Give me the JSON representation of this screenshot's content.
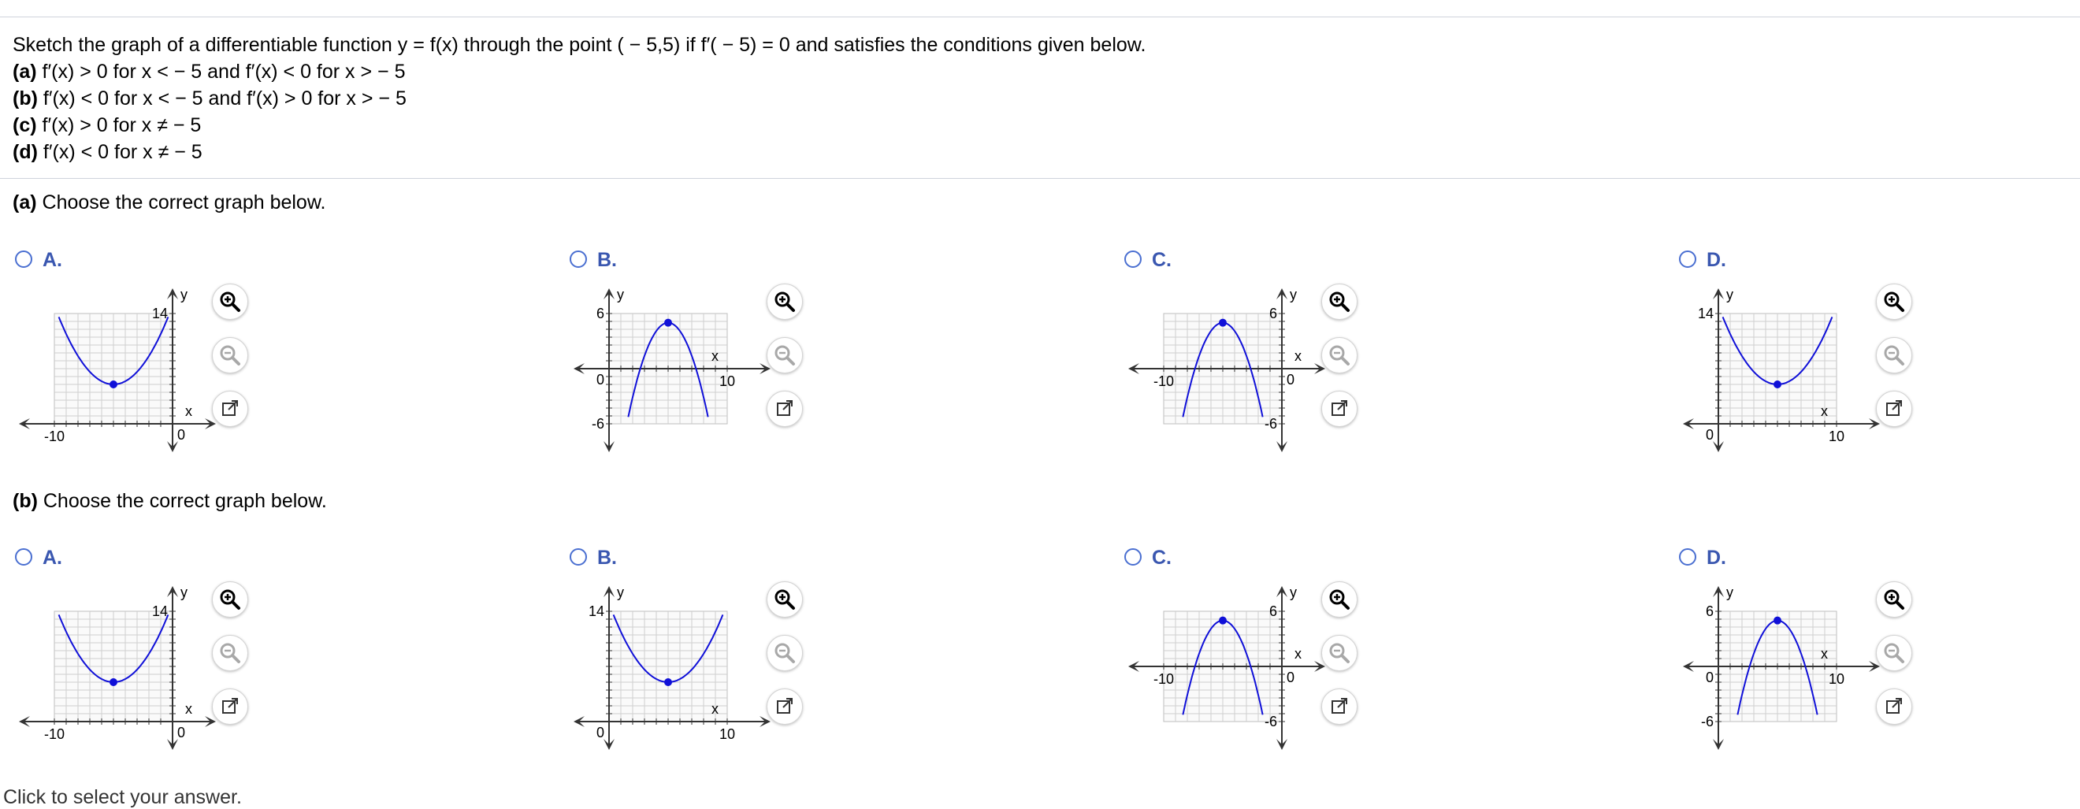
{
  "problem": {
    "intro": "Sketch the graph of a differentiable function y = f(x) through the point ( − 5,5) if f′( − 5) = 0 and satisfies the conditions given below.",
    "conditions": [
      {
        "label": "(a)",
        "text": "f′(x) > 0 for x < − 5 and f′(x) < 0 for x > − 5"
      },
      {
        "label": "(b)",
        "text": "f′(x) < 0 for x < − 5 and f′(x) > 0 for x > − 5"
      },
      {
        "label": "(c)",
        "text": "f′(x) > 0 for x ≠ − 5"
      },
      {
        "label": "(d)",
        "text": "f′(x) < 0 for x ≠ − 5"
      }
    ]
  },
  "parts": [
    {
      "label": "(a)",
      "prompt": "Choose the correct graph below.",
      "choices": [
        {
          "letter": "A.",
          "graph": {
            "shape": "up",
            "x_range": [
              -10,
              0
            ],
            "y_range": [
              0,
              14
            ],
            "x_tick": "-10",
            "y_tick": "14",
            "origin_tick": "0",
            "x_axis_label": "x",
            "y_axis_label": "y"
          }
        },
        {
          "letter": "B.",
          "graph": {
            "shape": "down",
            "x_range": [
              0,
              10
            ],
            "y_range": [
              -6,
              6
            ],
            "x_tick": "10",
            "y_tick": "6",
            "y_tick_neg": "-6",
            "origin_tick": "0",
            "x_axis_label": "x",
            "y_axis_label": "y"
          }
        },
        {
          "letter": "C.",
          "graph": {
            "shape": "down",
            "x_range": [
              -10,
              0
            ],
            "y_range": [
              -6,
              6
            ],
            "x_tick": "-10",
            "y_tick": "6",
            "y_tick_neg": "-6",
            "origin_tick": "0",
            "x_axis_label": "x",
            "y_axis_label": "y"
          }
        },
        {
          "letter": "D.",
          "graph": {
            "shape": "up",
            "x_range": [
              0,
              10
            ],
            "y_range": [
              0,
              14
            ],
            "x_tick": "10",
            "y_tick": "14",
            "origin_tick": "0",
            "x_axis_label": "x",
            "y_axis_label": "y"
          }
        }
      ]
    },
    {
      "label": "(b)",
      "prompt": "Choose the correct graph below.",
      "choices": [
        {
          "letter": "A.",
          "graph": {
            "shape": "up",
            "x_range": [
              -10,
              0
            ],
            "y_range": [
              0,
              14
            ],
            "x_tick": "-10",
            "y_tick": "14",
            "origin_tick": "0",
            "x_axis_label": "x",
            "y_axis_label": "y"
          }
        },
        {
          "letter": "B.",
          "graph": {
            "shape": "up",
            "x_range": [
              0,
              10
            ],
            "y_range": [
              0,
              14
            ],
            "x_tick": "10",
            "y_tick": "14",
            "origin_tick": "0",
            "x_axis_label": "x",
            "y_axis_label": "y"
          }
        },
        {
          "letter": "C.",
          "graph": {
            "shape": "down",
            "x_range": [
              -10,
              0
            ],
            "y_range": [
              -6,
              6
            ],
            "x_tick": "-10",
            "y_tick": "6",
            "y_tick_neg": "-6",
            "origin_tick": "0",
            "x_axis_label": "x",
            "y_axis_label": "y"
          }
        },
        {
          "letter": "D.",
          "graph": {
            "shape": "down",
            "x_range": [
              0,
              10
            ],
            "y_range": [
              -6,
              6
            ],
            "x_tick": "10",
            "y_tick": "6",
            "y_tick_neg": "-6",
            "origin_tick": "0",
            "x_axis_label": "x",
            "y_axis_label": "y"
          }
        }
      ]
    }
  ],
  "tools": {
    "zoom_in": "zoom-in-icon",
    "zoom_out": "zoom-out-icon",
    "popout": "popout-icon"
  },
  "colors": {
    "curve": "#1010d8",
    "grid": "#cfcfcf",
    "axis": "#333333",
    "radio": "#4a6fd1",
    "letter": "#3a57b0"
  },
  "footer": "Click to select your answer."
}
